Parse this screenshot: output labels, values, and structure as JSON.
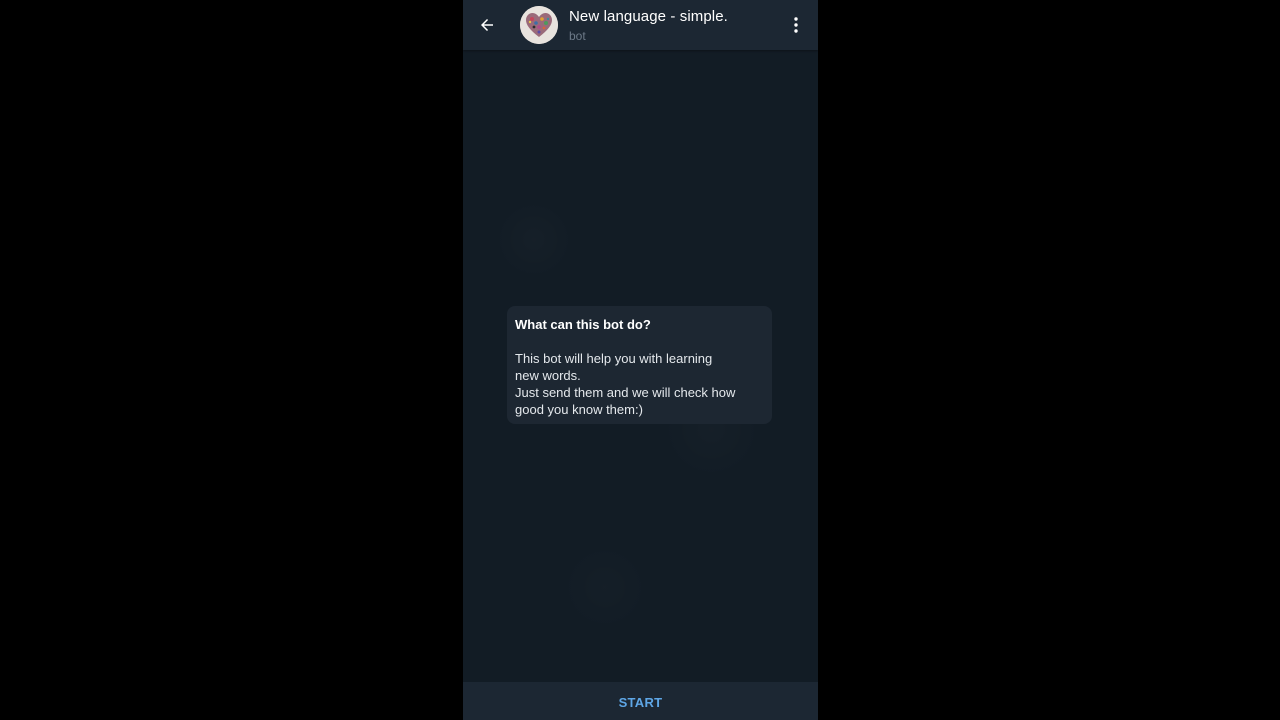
{
  "chat": {
    "title": "New language - simple.",
    "subtitle": "bot"
  },
  "info_card": {
    "heading": "What can this bot do?",
    "description": "This bot will help you with learning\nnew words.\nJust send them and we will check how\ngood you know them:)"
  },
  "bottom_bar": {
    "start_label": "START"
  },
  "icons": {
    "back": "arrow-left-icon",
    "menu": "more-vertical-icon",
    "avatar": "heart-mosaic-avatar"
  },
  "colors": {
    "background": "#000000",
    "chat_background": "#121c25",
    "header": "#1c2733",
    "card": "#1d2732",
    "accent": "#5ea6e6",
    "subtitle": "#6d7a88"
  }
}
